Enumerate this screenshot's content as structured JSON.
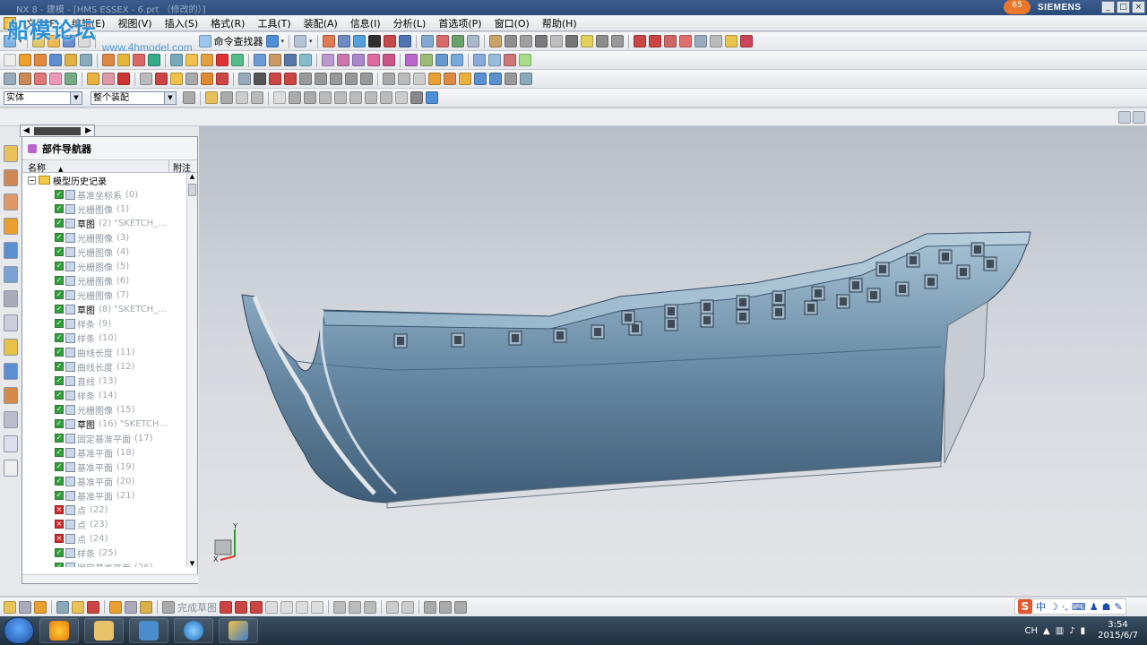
{
  "window": {
    "title": "NX 8 - 建模 - [HMS ESSEX - 6.prt （修改的）]",
    "brand": "SIEMENS",
    "badge": "65",
    "controls": [
      "_",
      "□",
      "×"
    ]
  },
  "watermark": {
    "logo": "船模论坛",
    "url": "www.4hmodel.com"
  },
  "menu": [
    "文件(F)",
    "编辑(E)",
    "视图(V)",
    "插入(S)",
    "格式(R)",
    "工具(T)",
    "装配(A)",
    "信息(I)",
    "分析(L)",
    "首选项(P)",
    "窗口(O)",
    "帮助(H)"
  ],
  "toolbar": {
    "command_finder": "命令查找器",
    "filter_select": "实体",
    "scope_select": "整个装配"
  },
  "navigator": {
    "title": "部件导航器",
    "col_name": "名称",
    "col_note": "附注",
    "root": "模型历史记录",
    "rows": [
      {
        "status": "ok",
        "name": "基准坐标系",
        "idx": "(0)"
      },
      {
        "status": "ok",
        "name": "光栅图像",
        "idx": "(1)"
      },
      {
        "status": "ok",
        "name": "草图",
        "idx": "(2) \"SKETCH_...",
        "active": true
      },
      {
        "status": "ok",
        "name": "光栅图像",
        "idx": "(3)"
      },
      {
        "status": "ok",
        "name": "光栅图像",
        "idx": "(4)"
      },
      {
        "status": "ok",
        "name": "光栅图像",
        "idx": "(5)"
      },
      {
        "status": "ok",
        "name": "光栅图像",
        "idx": "(6)"
      },
      {
        "status": "ok",
        "name": "光栅图像",
        "idx": "(7)"
      },
      {
        "status": "ok",
        "name": "草图",
        "idx": "(8) \"SKETCH_...",
        "active": true
      },
      {
        "status": "ok",
        "name": "样条",
        "idx": "(9)"
      },
      {
        "status": "ok",
        "name": "样条",
        "idx": "(10)"
      },
      {
        "status": "ok",
        "name": "曲线长度",
        "idx": "(11)"
      },
      {
        "status": "ok",
        "name": "曲线长度",
        "idx": "(12)"
      },
      {
        "status": "ok",
        "name": "直线",
        "idx": "(13)"
      },
      {
        "status": "ok",
        "name": "样条",
        "idx": "(14)"
      },
      {
        "status": "ok",
        "name": "光栅图像",
        "idx": "(15)"
      },
      {
        "status": "ok",
        "name": "草图",
        "idx": "(16) \"SKETCH...",
        "active": true
      },
      {
        "status": "ok",
        "name": "固定基准平面",
        "idx": "(17)"
      },
      {
        "status": "ok",
        "name": "基准平面",
        "idx": "(18)"
      },
      {
        "status": "ok",
        "name": "基准平面",
        "idx": "(19)"
      },
      {
        "status": "ok",
        "name": "基准平面",
        "idx": "(20)"
      },
      {
        "status": "ok",
        "name": "基准平面",
        "idx": "(21)"
      },
      {
        "status": "error",
        "name": "点",
        "idx": "(22)"
      },
      {
        "status": "error",
        "name": "点",
        "idx": "(23)"
      },
      {
        "status": "error",
        "name": "点",
        "idx": "(24)"
      },
      {
        "status": "ok",
        "name": "样条",
        "idx": "(25)"
      },
      {
        "status": "ok",
        "name": "固定基准平面",
        "idx": "(26)"
      }
    ]
  },
  "bottom_toolbar": {
    "finish_sketch": "完成草图"
  },
  "triad": {
    "y": "Y",
    "x": "X"
  },
  "taskbar": {
    "lang": "CH",
    "time": "3:54",
    "date": "2015/6/7"
  },
  "ime": {
    "mode": "中"
  },
  "colors": {
    "hull": "#5b7f9c",
    "hull_light": "#9bbbd0",
    "titlebar": "#2b4a79"
  }
}
